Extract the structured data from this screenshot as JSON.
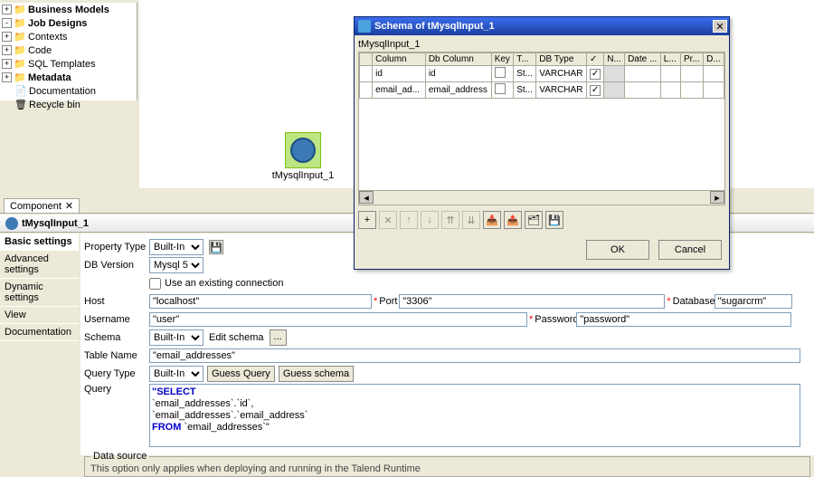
{
  "tree": {
    "items": [
      {
        "label": "Business Models",
        "bold": true,
        "exp": "+",
        "icon": "📁"
      },
      {
        "label": "Job Designs",
        "bold": true,
        "exp": "-",
        "icon": "📁"
      },
      {
        "label": "Contexts",
        "bold": false,
        "exp": "+",
        "icon": "📁"
      },
      {
        "label": "Code",
        "bold": false,
        "exp": "+",
        "icon": "📁"
      },
      {
        "label": "SQL Templates",
        "bold": false,
        "exp": "+",
        "icon": "📁"
      },
      {
        "label": "Metadata",
        "bold": true,
        "exp": "+",
        "icon": "📁"
      },
      {
        "label": "Documentation",
        "bold": false,
        "exp": "",
        "icon": "📄"
      },
      {
        "label": "Recycle bin",
        "bold": false,
        "exp": "",
        "icon": "🗑"
      }
    ]
  },
  "canvas": {
    "node_label": "tMysqlInput_1"
  },
  "component_tab": {
    "label": "Component",
    "close": "✕"
  },
  "comp_header": {
    "title": "tMysqlInput_1"
  },
  "settings_nav": [
    "Basic settings",
    "Advanced settings",
    "Dynamic settings",
    "View",
    "Documentation"
  ],
  "props": {
    "property_type_label": "Property Type",
    "property_type_value": "Built-In",
    "db_version_label": "DB Version",
    "db_version_value": "Mysql 5",
    "use_existing_label": "Use an existing connection",
    "host_label": "Host",
    "host_value": "\"localhost\"",
    "port_label": "Port",
    "port_value": "\"3306\"",
    "database_label": "Database",
    "database_value": "\"sugarcrm\"",
    "username_label": "Username",
    "username_value": "\"user\"",
    "password_label": "Password",
    "password_value": "\"password\"",
    "schema_label": "Schema",
    "schema_value": "Built-In",
    "edit_schema_label": "Edit schema",
    "table_label": "Table Name",
    "table_value": "\"email_addresses\"",
    "query_type_label": "Query Type",
    "query_type_value": "Built-In",
    "guess_query": "Guess Query",
    "guess_schema": "Guess schema",
    "query_label": "Query",
    "sql_select": "\"SELECT",
    "sql_l1": "  `email_addresses`.`id`,",
    "sql_l2": "  `email_addresses`.`email_address`",
    "sql_from": "FROM `email_addresses`\"",
    "datasource_legend": "Data source",
    "datasource_note": "This option only applies when deploying and running in the Talend Runtime"
  },
  "dialog": {
    "title": "Schema of tMysqlInput_1",
    "subtitle": "tMysqlInput_1",
    "headers": [
      "",
      "Column",
      "Db Column",
      "Key",
      "T...",
      "DB Type",
      "✓",
      "N...",
      "Date ...",
      "L...",
      "Pr...",
      "D..."
    ],
    "rows": [
      {
        "col": "id",
        "dbcol": "id",
        "key": false,
        "t": "St...",
        "dbtype": "VARCHAR",
        "n": true
      },
      {
        "col": "email_ad...",
        "dbcol": "email_address",
        "key": false,
        "t": "St...",
        "dbtype": "VARCHAR",
        "n": true
      }
    ],
    "toolbar_icons": [
      "+",
      "✕",
      "↑",
      "↓",
      "⇈",
      "⇊",
      "📥",
      "📤",
      "🗂",
      "💾"
    ],
    "ok": "OK",
    "cancel": "Cancel",
    "close": "✕"
  }
}
